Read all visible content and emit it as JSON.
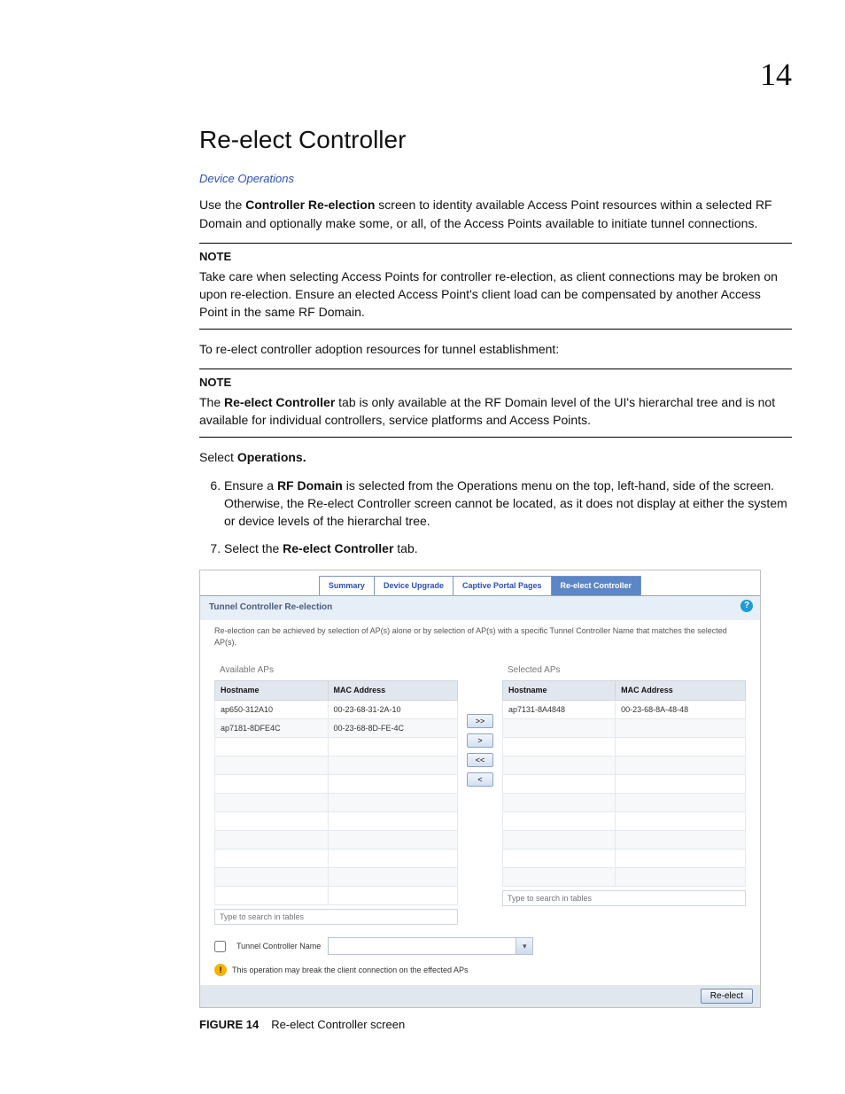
{
  "page": {
    "chapter_number": "14",
    "title": "Re-elect Controller",
    "breadcrumb": "Device Operations",
    "intro_pre": "Use the ",
    "intro_bold": "Controller Re-election",
    "intro_post": " screen to identity available Access Point resources within a selected RF Domain and optionally make some, or all, of the Access Points available to initiate tunnel connections.",
    "note1_head": "NOTE",
    "note1_body": "Take care when selecting Access Points for controller re-election, as client connections may be broken on upon re-election. Ensure an elected Access Point's client load can be compensated by another Access Point in the same RF Domain.",
    "para2": "To re-elect controller adoption resources for tunnel establishment:",
    "note2_head": "NOTE",
    "note2_pre": "The ",
    "note2_bold": "Re-elect Controller",
    "note2_post": " tab is only available at the RF Domain level of the UI's hierarchal tree and is not available for individual controllers, service platforms and Access Points.",
    "select_pre": "Select ",
    "select_bold": "Operations.",
    "step6_pre": "Ensure a ",
    "step6_bold": "RF Domain",
    "step6_post": " is selected from the Operations menu on the top, left-hand, side of the screen. Otherwise, the Re-elect Controller screen cannot be located, as it does not display at either the system or device levels of the hierarchal tree.",
    "step7_pre": "Select the ",
    "step7_bold": "Re-elect Controller",
    "step7_post": " tab.",
    "figure_label": "FIGURE 14",
    "figure_caption": "Re-elect Controller screen"
  },
  "shot": {
    "tabs": [
      "Summary",
      "Device Upgrade",
      "Captive Portal Pages",
      "Re-elect Controller"
    ],
    "active_tab_index": 3,
    "section_title": "Tunnel Controller Re-election",
    "help_icon": "?",
    "desc": "Re-election can be achieved by selection of AP(s) alone or by selection of AP(s) with a specific Tunnel Controller Name that matches the selected AP(s).",
    "available_title": "Available APs",
    "selected_title": "Selected APs",
    "col_host": "Hostname",
    "col_mac": "MAC Address",
    "available_rows": [
      {
        "host": "ap650-312A10",
        "mac": "00-23-68-31-2A-10"
      },
      {
        "host": "ap7181-8DFE4C",
        "mac": "00-23-68-8D-FE-4C"
      }
    ],
    "selected_rows": [
      {
        "host": "ap7131-8A4848",
        "mac": "00-23-68-8A-48-48"
      }
    ],
    "blank_row_count": 9,
    "search_placeholder": "Type to search in tables",
    "move_all_right": ">>",
    "move_right": ">",
    "move_all_left": "<<",
    "move_left": "<",
    "tcn_label": "Tunnel Controller Name",
    "combo_arrow": "▾",
    "warning_icon": "!",
    "warning_text": "This operation may break the client connection on the effected APs",
    "reelect_button": "Re-elect"
  }
}
